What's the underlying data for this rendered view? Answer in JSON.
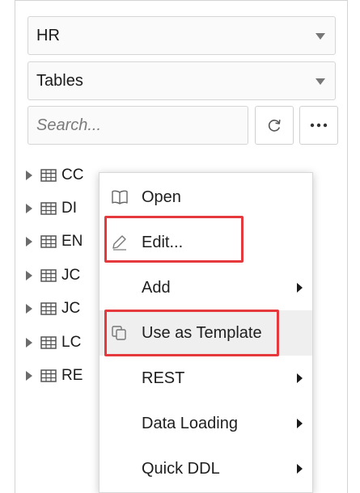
{
  "navigator": {
    "schema_select": {
      "value": "HR"
    },
    "object_type_select": {
      "value": "Tables"
    },
    "search": {
      "placeholder": "Search..."
    },
    "refresh_icon": "refresh-icon",
    "more_icon": "more-horizontal-icon"
  },
  "tree": {
    "rows": [
      {
        "label": "CC"
      },
      {
        "label": "DI"
      },
      {
        "label": "EN"
      },
      {
        "label": "JC"
      },
      {
        "label": "JC"
      },
      {
        "label": "LC"
      },
      {
        "label": "RE"
      }
    ],
    "row_icon": "table-icon"
  },
  "context_menu": {
    "items": [
      {
        "label": "Open",
        "icon": "book-icon",
        "has_submenu": false,
        "highlighted": false
      },
      {
        "label": "Edit...",
        "icon": "pencil-icon",
        "has_submenu": false,
        "highlighted": true
      },
      {
        "label": "Add",
        "icon": "",
        "has_submenu": true,
        "highlighted": false
      },
      {
        "label": "Use as Template",
        "icon": "copy-icon",
        "has_submenu": false,
        "highlighted": true
      },
      {
        "label": "REST",
        "icon": "",
        "has_submenu": true,
        "highlighted": false
      },
      {
        "label": "Data Loading",
        "icon": "",
        "has_submenu": true,
        "highlighted": false
      },
      {
        "label": "Quick DDL",
        "icon": "",
        "has_submenu": true,
        "highlighted": false
      }
    ],
    "hovered_item": "Use as Template"
  },
  "colors": {
    "highlight_border": "#e5393d",
    "hover_background": "#efefef"
  }
}
